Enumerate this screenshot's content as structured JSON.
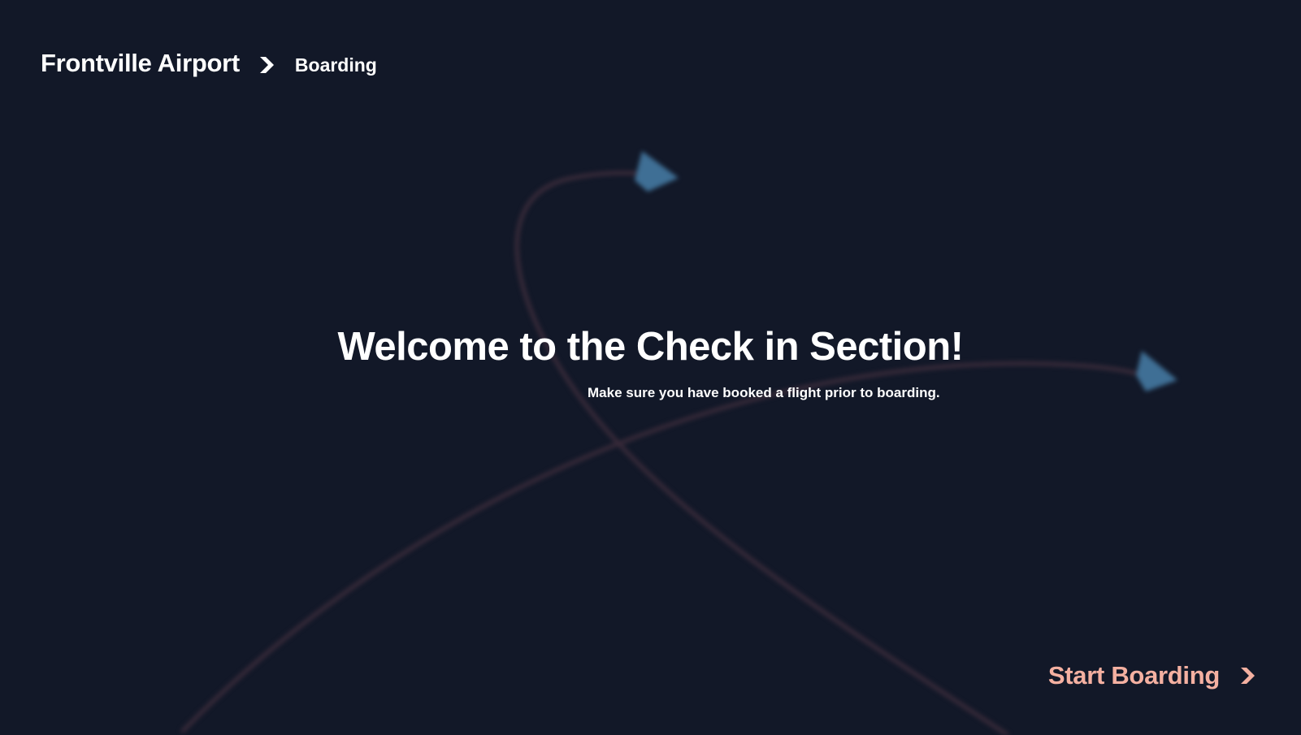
{
  "header": {
    "brand": "Frontville Airport",
    "separator_icon": "chevron-right-icon",
    "current_page": "Boarding"
  },
  "hero": {
    "title": "Welcome to the Check in Section!",
    "subtitle": "Make sure you have booked a flight prior to boarding."
  },
  "actions": {
    "start_label": "Start Boarding",
    "start_icon": "chevron-right-icon"
  },
  "theme": {
    "background": "#121828",
    "text": "#ffffff",
    "accent": "#f4b0a1",
    "plane_color": "#3f6f95",
    "trail_color": "#3a2b3a"
  }
}
